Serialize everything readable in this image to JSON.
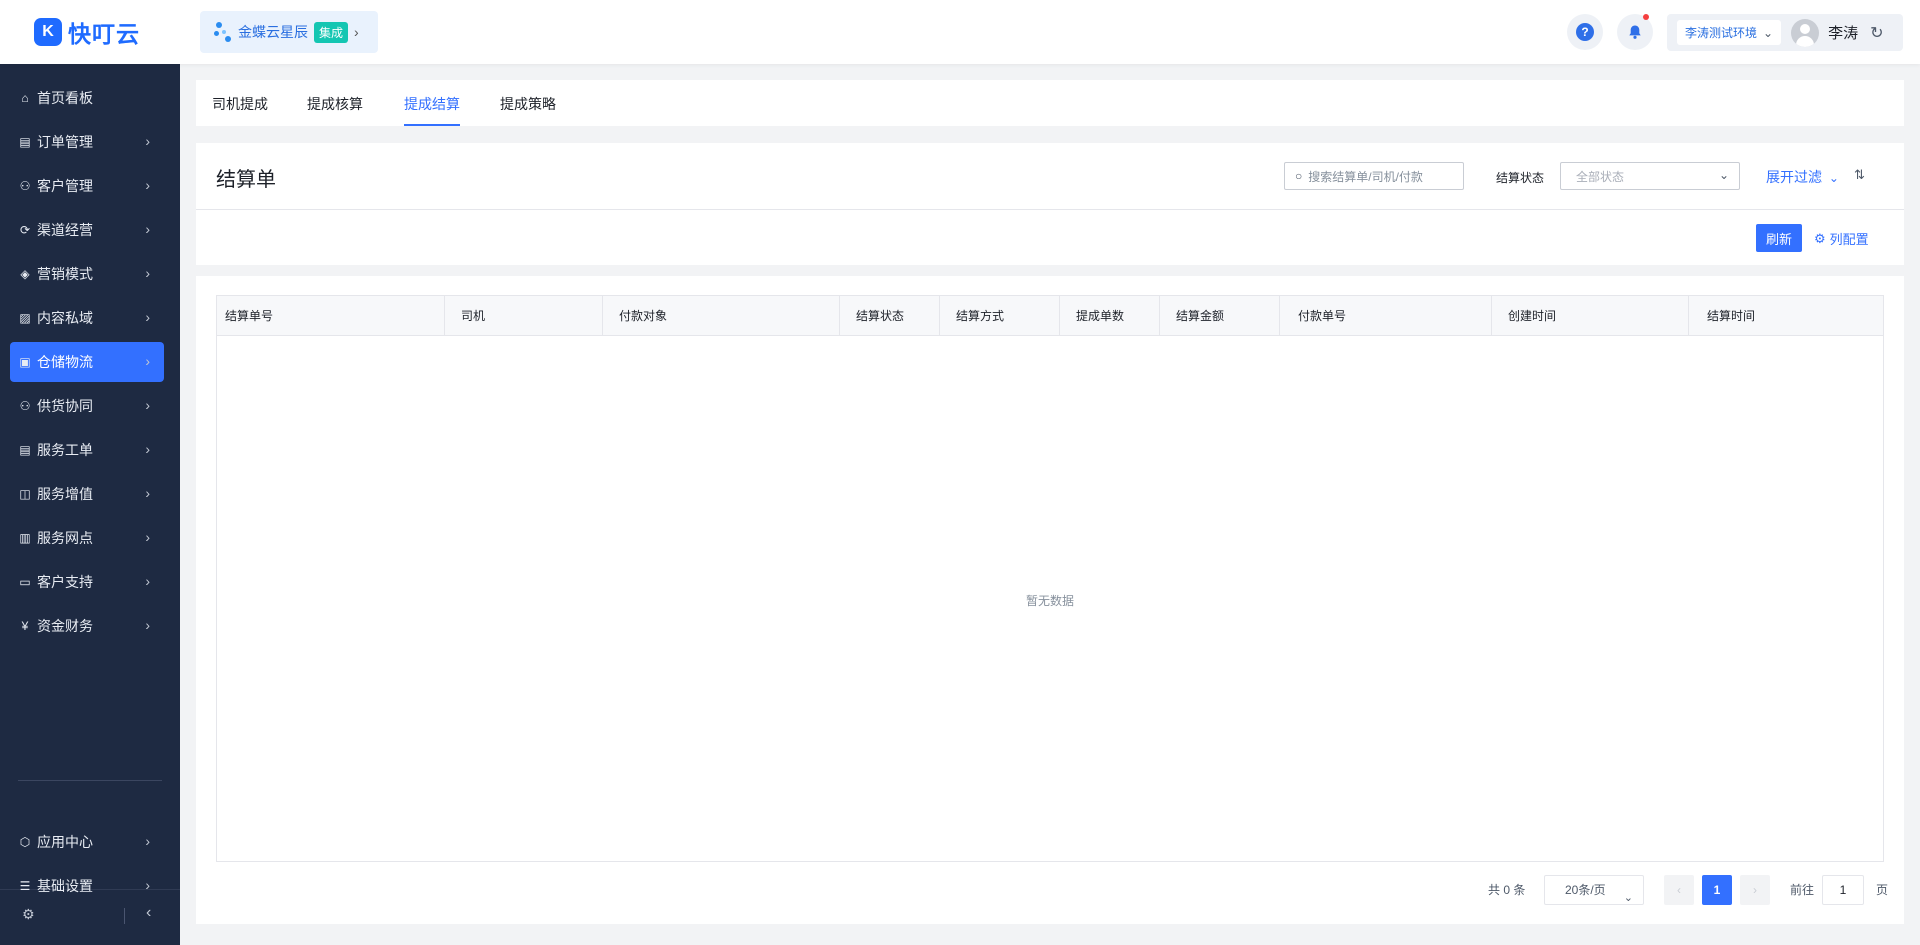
{
  "header": {
    "logo_glyph": "K",
    "logo_text": "快叮云",
    "org_name": "金蝶云星辰",
    "org_tag": "集成",
    "help_glyph": "?",
    "env_select": "李涛测试环境",
    "user_name": "李涛"
  },
  "sidebar": {
    "items": [
      {
        "label": "首页看板",
        "icon": "home-icon",
        "glyph": "⌂"
      },
      {
        "label": "订单管理",
        "icon": "clipboard-icon",
        "glyph": "▤"
      },
      {
        "label": "客户管理",
        "icon": "user-icon",
        "glyph": "⚇"
      },
      {
        "label": "渠道经营",
        "icon": "channel-icon",
        "glyph": "⟳"
      },
      {
        "label": "营销模式",
        "icon": "tag-icon",
        "glyph": "◈"
      },
      {
        "label": "内容私域",
        "icon": "image-icon",
        "glyph": "▨"
      },
      {
        "label": "仓储物流",
        "icon": "warehouse-icon",
        "glyph": "▣"
      },
      {
        "label": "供货协同",
        "icon": "supply-icon",
        "glyph": "⚇"
      },
      {
        "label": "服务工单",
        "icon": "ticket-icon",
        "glyph": "▤"
      },
      {
        "label": "服务增值",
        "icon": "bag-icon",
        "glyph": "◫"
      },
      {
        "label": "服务网点",
        "icon": "store-icon",
        "glyph": "▥"
      },
      {
        "label": "客户支持",
        "icon": "support-icon",
        "glyph": "▭"
      },
      {
        "label": "资金财务",
        "icon": "yen-icon",
        "glyph": "¥"
      },
      {
        "label": "应用中心",
        "icon": "cube-icon",
        "glyph": "⬡"
      },
      {
        "label": "基础设置",
        "icon": "settings-list-icon",
        "glyph": "☰"
      }
    ],
    "active_index": 6
  },
  "tabs": [
    {
      "label": "司机提成"
    },
    {
      "label": "提成核算"
    },
    {
      "label": "提成结算"
    },
    {
      "label": "提成策略"
    }
  ],
  "active_tab": 2,
  "list": {
    "title": "结算单",
    "search_placeholder": "搜索结算单/司机/付款",
    "status_label": "结算状态",
    "status_value": "全部状态",
    "expand_filter": "展开过滤",
    "refresh_button": "刷新",
    "columns_button": "列配置"
  },
  "table": {
    "columns": [
      "结算单号",
      "司机",
      "付款对象",
      "结算状态",
      "结算方式",
      "提成单数",
      "结算金额",
      "付款单号",
      "创建时间",
      "结算时间"
    ],
    "empty_text": "暂无数据"
  },
  "pagination": {
    "total": "共 0 条",
    "page_size": "20条/页",
    "current_page": "1",
    "goto_label": "前往",
    "goto_value": "1",
    "page_unit": "页"
  },
  "colors": {
    "accent": "#3370ff",
    "sidebar_bg": "#1e2a42",
    "page_bg": "#f2f3f5",
    "tag_teal": "#14c6b2"
  }
}
